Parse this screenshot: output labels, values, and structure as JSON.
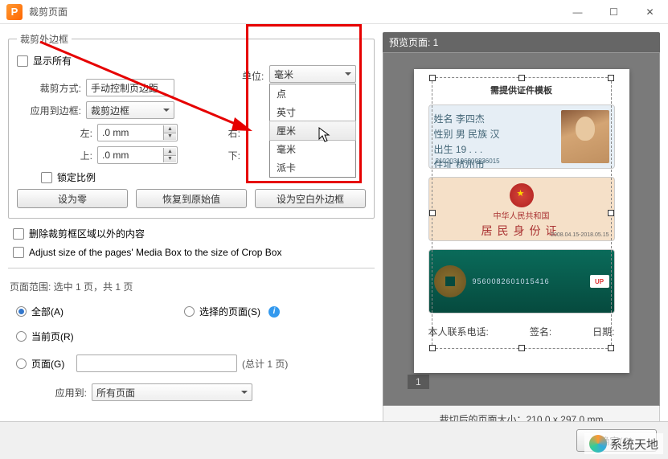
{
  "window": {
    "title": "裁剪页面",
    "app_letter": "P"
  },
  "win_btns": {
    "min": "—",
    "max": "☐",
    "close": "✕"
  },
  "groupbox": {
    "title": "裁剪外边框"
  },
  "show_all": {
    "label": "显示所有"
  },
  "unit": {
    "label": "单位:",
    "selected": "毫米",
    "options": [
      "点",
      "英寸",
      "厘米",
      "毫米",
      "派卡"
    ]
  },
  "crop_mode": {
    "label": "裁剪方式:",
    "value": "手动控制页边距"
  },
  "apply_border": {
    "label": "应用到边框:",
    "value": "裁剪边框"
  },
  "margins": {
    "left_lbl": "左:",
    "left_val": ".0 mm",
    "right_lbl": "右:",
    "top_lbl": "上:",
    "top_val": ".0 mm",
    "bottom_lbl": "下:"
  },
  "lock_ratio": {
    "label": "锁定比例"
  },
  "buttons": {
    "zero": "设为零",
    "reset": "恢复到原始值",
    "blank": "设为空白外边框"
  },
  "extra": {
    "remove_outside": "删除裁剪框区域以外的内容",
    "adjust_media": "Adjust size of the pages' Media Box to the size of Crop Box"
  },
  "range": {
    "title": "页面范围: 选中 1 页，共 1 页",
    "all": "全部(A)",
    "selected": "选择的页面(S)",
    "current": "当前页(R)",
    "pages": "页面(G)",
    "total": "(总计 1 页)",
    "apply_to_lbl": "应用到:",
    "apply_to_val": "所有页面"
  },
  "preview": {
    "header": "预览页面: 1",
    "page_num": "1",
    "footer": "裁切后的页面大小：210.0 x 297.0 mm",
    "doc_title": "需提供证件模板",
    "id1": {
      "name": "姓名  李四杰",
      "gender": "性别  男    民族  汉",
      "birth": "出生  19 . . .",
      "addr": "住址  杭州市",
      "num": "210203196809236015"
    },
    "id2": {
      "t1": "中华人民共和国",
      "t2": "居民身份证",
      "dates": "2008.04.15-2018.05.15"
    },
    "id3": {
      "num": "9560082601015416",
      "logo": "UP"
    },
    "doc_foot": {
      "a": "本人联系电话:",
      "b": "签名:",
      "c": "日期:"
    }
  },
  "footer": {
    "ok": "确定(O)"
  },
  "watermark": "系统天地"
}
